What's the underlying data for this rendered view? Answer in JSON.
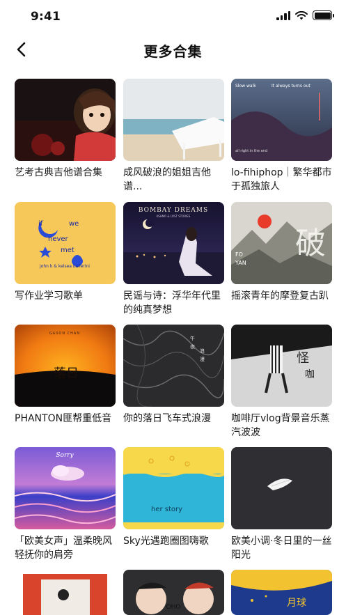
{
  "status": {
    "time": "9:41"
  },
  "header": {
    "title": "更多合集",
    "back_icon": "chevron-left-icon"
  },
  "playlists": [
    {
      "title": "艺考古典吉他谱合集"
    },
    {
      "title": "成风破浪的姐姐吉他谱..."
    },
    {
      "title": "lo-fihiphop｜繁华都市于孤独旅人",
      "cover_text": [
        "Slow walk",
        "It always turns out",
        "all right in the end"
      ]
    },
    {
      "title": "写作业学习歌单",
      "cover_text": [
        "if",
        "we",
        "never",
        "met",
        "john k & kelsea ballerini"
      ]
    },
    {
      "title": "民谣与诗：浮华年代里的纯真梦想",
      "cover_text": [
        "BOMBAY DREAMS",
        "KSHMR & LOST STORIES"
      ]
    },
    {
      "title": "摇滚青年的摩登复古趴",
      "cover_text": [
        "FO",
        "YAN",
        "破"
      ]
    },
    {
      "title": "PHANTON匪帮重低音",
      "cover_text": [
        "GASON CHAN",
        "落日"
      ]
    },
    {
      "title": "你的落日飞车式浪漫",
      "cover_text": [
        "午",
        "夜",
        "浪",
        "漫"
      ]
    },
    {
      "title": "咖啡厅vlog背景音乐蒸汽波波",
      "cover_text": [
        "怪",
        "咖"
      ]
    },
    {
      "title": "「欧美女声」温柔晚风轻抚你的肩旁",
      "cover_text": [
        "Sorry"
      ]
    },
    {
      "title": "Sky光遇跑圈图嗨歌",
      "cover_text": [
        "her story"
      ]
    },
    {
      "title": "欧美小调·冬日里的一丝阳光"
    },
    {
      "title": ""
    },
    {
      "title": "",
      "cover_text": [
        "OHO"
      ]
    },
    {
      "title": "",
      "cover_text": [
        "月球"
      ]
    }
  ]
}
